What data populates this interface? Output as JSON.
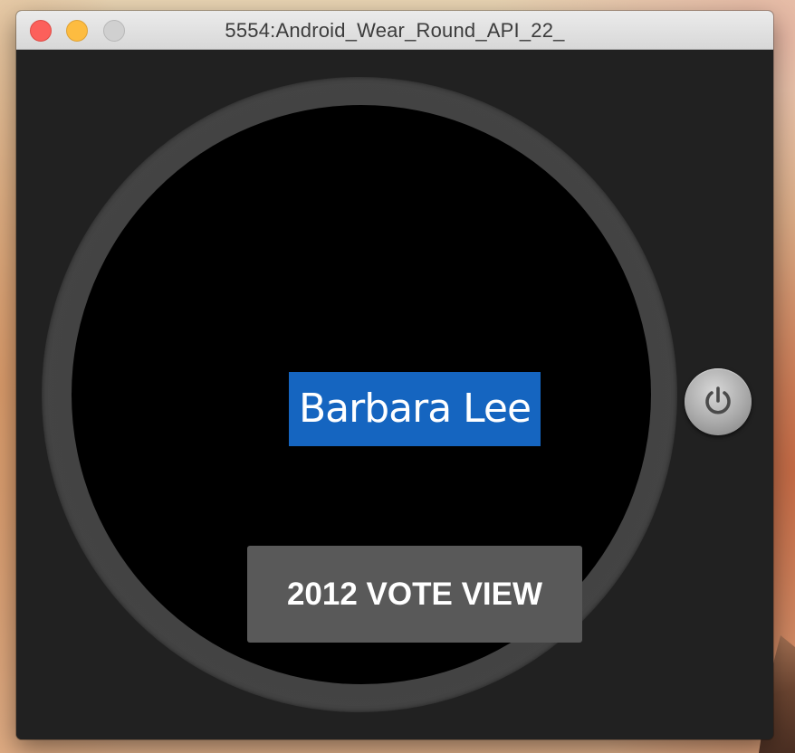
{
  "window": {
    "title": "5554:Android_Wear_Round_API_22_"
  },
  "watch": {
    "name_label": "Barbara Lee",
    "vote_button_label": "2012 VOTE VIEW",
    "power_icon": "power-icon"
  },
  "colors": {
    "name_highlight": "#1565c0",
    "button_background": "#595959",
    "screen_background": "#000000",
    "close": "#fc605b",
    "minimize": "#fdbc40",
    "zoom": "#d0d0d0"
  }
}
